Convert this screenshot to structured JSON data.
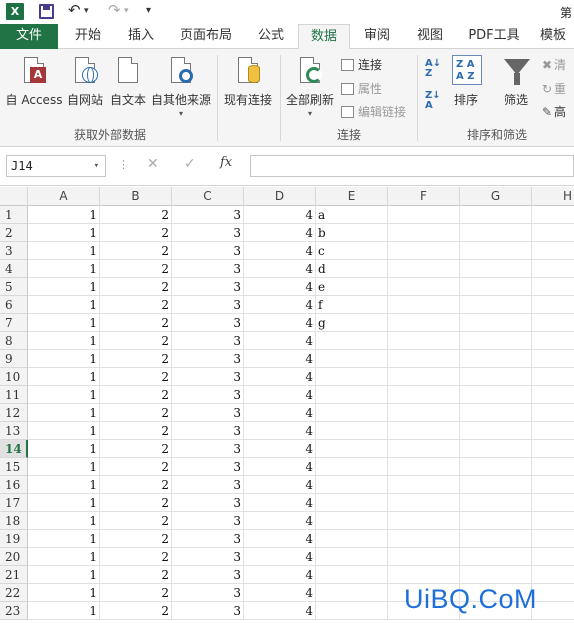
{
  "qat": {
    "app_icon_label": "X",
    "title_fragment": "第"
  },
  "tabs": [
    {
      "label": "文件",
      "id": "file"
    },
    {
      "label": "开始",
      "id": "home"
    },
    {
      "label": "插入",
      "id": "insert"
    },
    {
      "label": "页面布局",
      "id": "page-layout"
    },
    {
      "label": "公式",
      "id": "formulas"
    },
    {
      "label": "数据",
      "id": "data"
    },
    {
      "label": "审阅",
      "id": "review"
    },
    {
      "label": "视图",
      "id": "view"
    },
    {
      "label": "PDF工具",
      "id": "pdf-tools"
    },
    {
      "label": "模板",
      "id": "templates"
    }
  ],
  "active_tab": "数据",
  "ribbon": {
    "external": {
      "from_access": "自 Access",
      "from_web": "自网站",
      "from_text": "自文本",
      "from_other": "自其他来源",
      "group": "获取外部数据"
    },
    "existing_connections": "现有连接",
    "connections": {
      "refresh_all": "全部刷新",
      "connections": "连接",
      "properties": "属性",
      "edit_links": "编辑链接",
      "group": "连接"
    },
    "sort_filter": {
      "sort": "排序",
      "filter": "筛选",
      "clear": "清",
      "reapply": "重",
      "advanced": "高",
      "group": "排序和筛选"
    }
  },
  "formula_bar": {
    "name_box": "J14",
    "fx": "fx",
    "cancel_glyph": "✕",
    "enter_glyph": "✓",
    "content": ""
  },
  "sheet": {
    "columns": [
      "A",
      "B",
      "C",
      "D",
      "E",
      "F",
      "G",
      "H"
    ],
    "selected_row": 14,
    "rows": [
      {
        "n": "1",
        "a": "1",
        "b": "2",
        "c": "3",
        "d": "4",
        "e": "a"
      },
      {
        "n": "2",
        "a": "1",
        "b": "2",
        "c": "3",
        "d": "4",
        "e": "b"
      },
      {
        "n": "3",
        "a": "1",
        "b": "2",
        "c": "3",
        "d": "4",
        "e": "c"
      },
      {
        "n": "4",
        "a": "1",
        "b": "2",
        "c": "3",
        "d": "4",
        "e": "d"
      },
      {
        "n": "5",
        "a": "1",
        "b": "2",
        "c": "3",
        "d": "4",
        "e": "e"
      },
      {
        "n": "6",
        "a": "1",
        "b": "2",
        "c": "3",
        "d": "4",
        "e": "f"
      },
      {
        "n": "7",
        "a": "1",
        "b": "2",
        "c": "3",
        "d": "4",
        "e": "g"
      },
      {
        "n": "8",
        "a": "1",
        "b": "2",
        "c": "3",
        "d": "4",
        "e": ""
      },
      {
        "n": "9",
        "a": "1",
        "b": "2",
        "c": "3",
        "d": "4",
        "e": ""
      },
      {
        "n": "10",
        "a": "1",
        "b": "2",
        "c": "3",
        "d": "4",
        "e": ""
      },
      {
        "n": "11",
        "a": "1",
        "b": "2",
        "c": "3",
        "d": "4",
        "e": ""
      },
      {
        "n": "12",
        "a": "1",
        "b": "2",
        "c": "3",
        "d": "4",
        "e": ""
      },
      {
        "n": "13",
        "a": "1",
        "b": "2",
        "c": "3",
        "d": "4",
        "e": ""
      },
      {
        "n": "14",
        "a": "1",
        "b": "2",
        "c": "3",
        "d": "4",
        "e": ""
      },
      {
        "n": "15",
        "a": "1",
        "b": "2",
        "c": "3",
        "d": "4",
        "e": ""
      },
      {
        "n": "16",
        "a": "1",
        "b": "2",
        "c": "3",
        "d": "4",
        "e": ""
      },
      {
        "n": "17",
        "a": "1",
        "b": "2",
        "c": "3",
        "d": "4",
        "e": ""
      },
      {
        "n": "18",
        "a": "1",
        "b": "2",
        "c": "3",
        "d": "4",
        "e": ""
      },
      {
        "n": "19",
        "a": "1",
        "b": "2",
        "c": "3",
        "d": "4",
        "e": ""
      },
      {
        "n": "20",
        "a": "1",
        "b": "2",
        "c": "3",
        "d": "4",
        "e": ""
      },
      {
        "n": "21",
        "a": "1",
        "b": "2",
        "c": "3",
        "d": "4",
        "e": ""
      },
      {
        "n": "22",
        "a": "1",
        "b": "2",
        "c": "3",
        "d": "4",
        "e": ""
      },
      {
        "n": "23",
        "a": "1",
        "b": "2",
        "c": "3",
        "d": "4",
        "e": ""
      }
    ]
  },
  "watermark": "UiBQ.CoM",
  "colors": {
    "excel_green": "#217346",
    "access_red": "#a4373a",
    "watermark_blue": "#1e6fd9"
  }
}
